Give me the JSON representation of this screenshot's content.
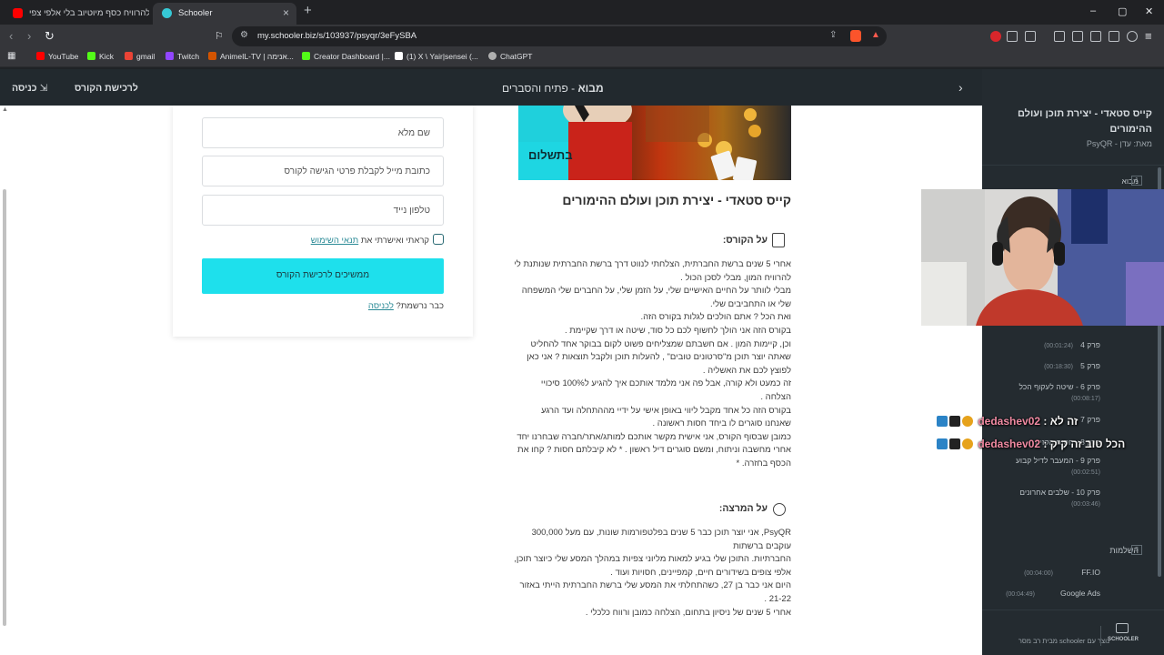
{
  "browser": {
    "tabs": [
      {
        "title": "איך להרוויח כסף מיוטיוב בלי אלפי צפי"
      },
      {
        "title": "Schooler",
        "close": "×"
      }
    ],
    "new_tab": "+",
    "window_controls": {
      "minimize": "–",
      "maximize": "▢",
      "close": "✕"
    },
    "url": "my.schooler.biz/s/103937/psyqr/3eFySBA",
    "bookmarks": [
      {
        "label": "YouTube",
        "color": "#ff0000"
      },
      {
        "label": "Kick",
        "color": "#53fc18"
      },
      {
        "label": "gmail",
        "color": "#ea4335"
      },
      {
        "label": "Twitch",
        "color": "#9146ff"
      },
      {
        "label": "AnimeIL-TV | אנימה...",
        "color": "#d35400"
      },
      {
        "label": "Creator Dashboard |...",
        "color": "#53fc18"
      },
      {
        "label": "(1) X \\ Yair|sensei (...",
        "color": "#ffffff"
      },
      {
        "label": "ChatGPT",
        "color": "#b0b0b0"
      }
    ]
  },
  "header": {
    "login": "כניסה",
    "purchase": "לרכישת הקורס",
    "section_bold": "מבוא",
    "section_rest": " - פתיח והסברים"
  },
  "form": {
    "full_name": "שם מלא",
    "email": "כתובת מייל לקבלת פרטי הגישה לקורס",
    "phone": "טלפון נייד",
    "terms_prefix": "קראתי ואישרתי את ",
    "terms_link": "תנאי השימוש",
    "submit": "ממשיכים לרכישת הקורס",
    "already_prefix": "כבר נרשמת? ",
    "already_link": "לכניסה"
  },
  "course": {
    "banner_label": "בתשלום",
    "title": "קייס סטאדי - יצירת תוכן ועולם ההימורים",
    "about_head": "על הקורס:",
    "about_lines": [
      "אחרי 5 שנים ברשת החברתית, הצלחתי לנווט דרך ברשת החברתית שנותנת לי",
      "להרוויח המון, מבלי לסכן הכול .",
      "מבלי לוותר על החיים האישיים שלי, על הזמן שלי, על החברים שלי המשפחה",
      "שלי או התחביבים שלי.",
      "ואת הכל ? אתם הולכים לגלות בקורס הזה.",
      "בקורס הזה אני הולך לחשוף לכם כל סוד, שיטה או דרך שקיימת .",
      "וכן, קיימות המון . אם חשבתם שמצליחים פשוט לקום בבוקר אחד להחליט",
      "שאתה יוצר תוכן מ\"סרטונים טובים\" , להעלות תוכן ולקבל תוצאות ? אני כאן",
      "לפוצץ לכם את האשליה .",
      "זה כמעט ולא קורה, אבל פה אני מלמד אותכם איך להגיע ל100% סיכויי",
      "הצלחה .",
      "בקורס הזה כל אחד מקבל ליווי באופן אישי על ידיי מההתחלה ועד הרגע",
      "שאנחנו סוגרים לו ביחד חסות ראשונה .",
      "כמובן שבסוף הקורס, אני אישית מקשר אותכם למותג/אתר/חברה שבחרנו יחד",
      "אחרי מחשבה וניתוח, ומשם סוגרים דיל ראשון . * לא קיבלתם חסות ? קחו את",
      "הכסף בחזרה. *"
    ],
    "lecturer_head": "על המרצה:",
    "lecturer_lines": [
      "PsyQR, אני יוצר תוכן כבר 5 שנים בפלטפורמות שונות, עם מעל 300,000",
      "עוקבים ברשתות",
      "החברתיות. התוכן שלי בגיע למאות מליוני צפיות במהלך המסע שלי כיוצר תוכן,",
      "אלפי צופים בשידורים חיים, קמפיינים, חסויות ועוד .",
      "היום אני כבר בן 27, כשהתחלתי את המסע שלי ברשת החברתית הייתי באזור",
      "21-22 .",
      "אחרי 5 שנים של ניסיון בתחום, הצלחה כמובן ורווח כלכלי ."
    ]
  },
  "sidebar": {
    "course_title_line1": "קייס סטאדי - יצירת תוכן ועולם",
    "course_title_line2": "ההימורים",
    "author": "מאת: עדן - PsyQR",
    "chapters": [
      {
        "num": "1",
        "label": "מבוא"
      },
      {
        "num": "3",
        "label": "השלמות"
      }
    ],
    "lessons": [
      {
        "label": "פרק 4",
        "time": "(00:01:24)"
      },
      {
        "label": "פרק 5",
        "time": "(00:18:30)"
      },
      {
        "label": "פרק 6 - שיטה לעקוף הכל",
        "time": "(00:08:17)"
      },
      {
        "label": "פרק 7",
        "time": ""
      },
      {
        "label": "פרק 8 - חסות הקזינו",
        "time": ""
      },
      {
        "label": "פרק 9 - המעבר לדיל קבוע",
        "time": "(00:02:51)"
      },
      {
        "label": "פרק 10 - שלבים אחרונים",
        "time": "(00:03:46)"
      }
    ],
    "extras": [
      {
        "label": "FF.IO",
        "time": "(00:04:00)"
      },
      {
        "label": "Google Ads",
        "time": "(00:04:49)"
      }
    ],
    "footer_text": "נוצר עם schooler מבית רב מסר",
    "footer_logo": "SCHOOLER"
  },
  "chat": [
    {
      "name": "dedashev02",
      "message": "זה לא"
    },
    {
      "name": "dedashev02",
      "message": "הכל טוב זה קיק"
    }
  ]
}
